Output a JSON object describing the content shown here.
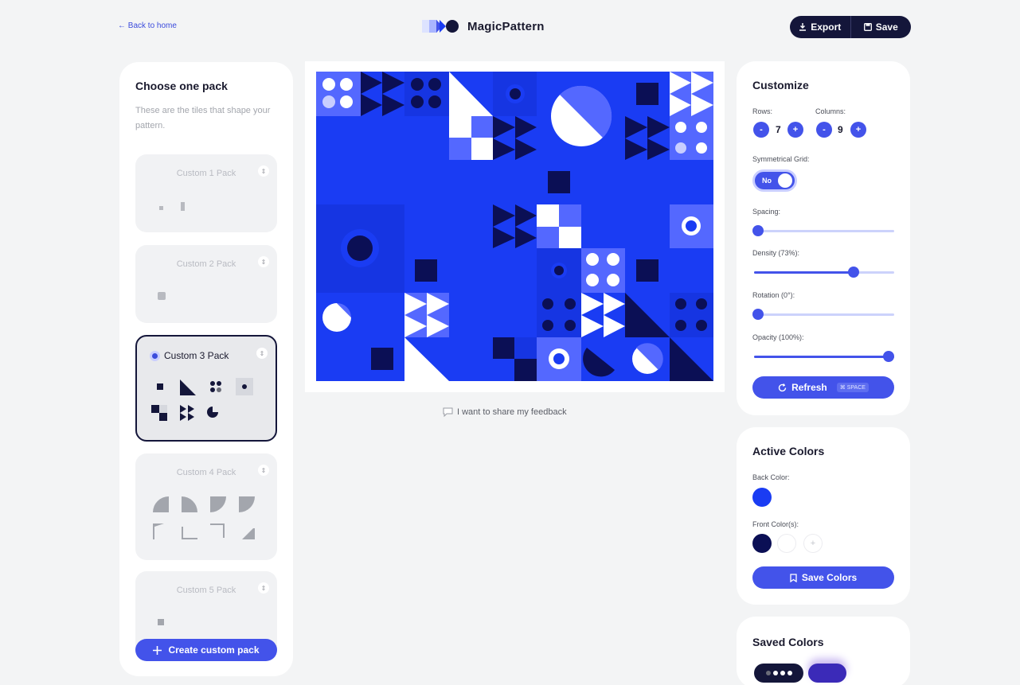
{
  "nav": {
    "back_label": "← Back to home"
  },
  "brand": {
    "name": "MagicPattern"
  },
  "actions": {
    "export_label": "Export",
    "save_label": "Save"
  },
  "packs_panel": {
    "title": "Choose one pack",
    "subtitle": "These are the tiles that shape your pattern.",
    "packs": [
      {
        "label": "Custom 1 Pack"
      },
      {
        "label": "Custom 2 Pack"
      },
      {
        "label": "Custom 3 Pack",
        "selected": true
      },
      {
        "label": "Custom 4 Pack"
      },
      {
        "label": "Custom 5 Pack"
      }
    ],
    "create_label": "Create custom pack"
  },
  "feedback": {
    "label": "I want to share my feedback"
  },
  "customize": {
    "title": "Customize",
    "rows_label": "Rows:",
    "rows_value": "7",
    "columns_label": "Columns:",
    "columns_value": "9",
    "minus": "-",
    "plus": "+",
    "symmetrical_label": "Symmetrical Grid:",
    "symmetrical_value": "No",
    "spacing_label": "Spacing:",
    "spacing_value": 0,
    "density_label": "Density (73%):",
    "density_value": 0.73,
    "rotation_label": "Rotation (0°):",
    "rotation_value": 0,
    "opacity_label": "Opacity (100%):",
    "opacity_value": 1.0,
    "refresh_label": "Refresh",
    "refresh_shortcut": "⌘ SPACE"
  },
  "active_colors": {
    "title": "Active Colors",
    "back_label": "Back Color:",
    "front_label": "Front Color(s):",
    "back_color": "#1a3cf3",
    "front_colors": [
      "#0b0f55",
      "#ffffff"
    ],
    "add_symbol": "+",
    "save_label": "Save Colors"
  },
  "saved_colors": {
    "title": "Saved Colors"
  },
  "colors": {
    "accent": "#4353ea",
    "pattern_bg": "#1a3cf3",
    "pattern_dark": "#0b0f55",
    "pattern_light": "#5468ff",
    "dark_navy": "#14163a"
  }
}
